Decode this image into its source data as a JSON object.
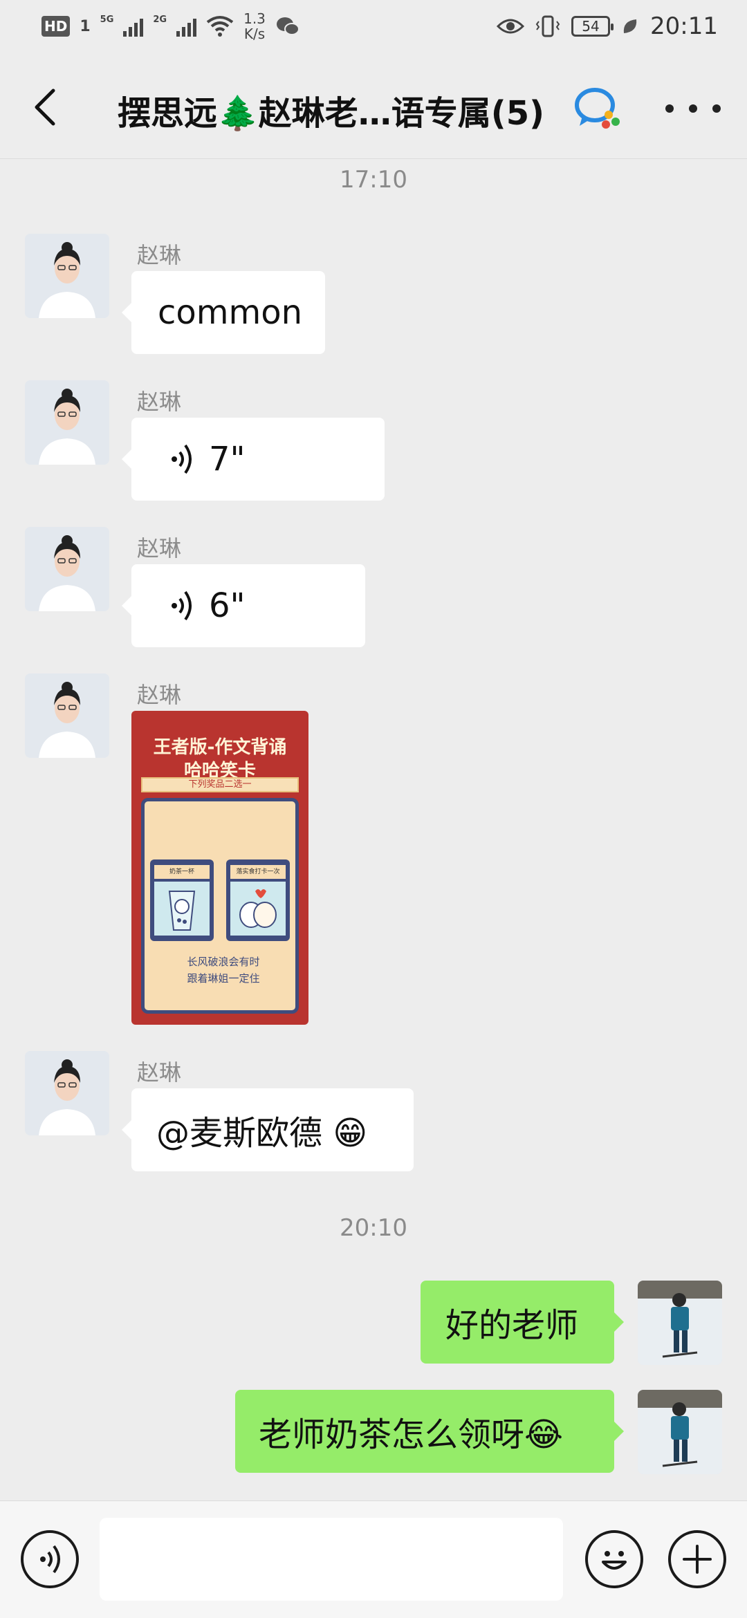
{
  "status_bar": {
    "hd": "HD",
    "sim1": "1",
    "net1": "5G",
    "net2": "2G",
    "speed_value": "1.3",
    "speed_unit": "K/s",
    "battery": "54",
    "time": "20:11"
  },
  "navbar": {
    "title": "摆思远🌲赵琳老…语专属(5)"
  },
  "messages": {
    "ts1": "17:10",
    "m1_sender": "赵琳",
    "m1_text": "common",
    "m2_sender": "赵琳",
    "m2_duration": "7\"",
    "m3_sender": "赵琳",
    "m3_duration": "6\"",
    "m4_sender": "赵琳",
    "m4_card": {
      "title1": "王者版-作文背诵",
      "title2": "哈哈笑卡",
      "subtitle": "下列奖品二选一",
      "prize1": "奶茶一杯",
      "prize2": "落实食打卡一次",
      "text1": "长风破浪会有时",
      "text2": "跟着琳姐一定住"
    },
    "m5_sender": "赵琳",
    "m5_text": "@麦斯欧德 😁",
    "ts2": "20:10",
    "m6_text": "好的老师",
    "m7_text": "老师奶茶怎么领呀😂"
  },
  "input": {
    "value": "",
    "placeholder": ""
  },
  "colors": {
    "background": "#ededed",
    "bubble_in": "#ffffff",
    "bubble_out": "#95ec69",
    "card_red": "#b9342f",
    "card_navy": "#3f4c7e"
  }
}
